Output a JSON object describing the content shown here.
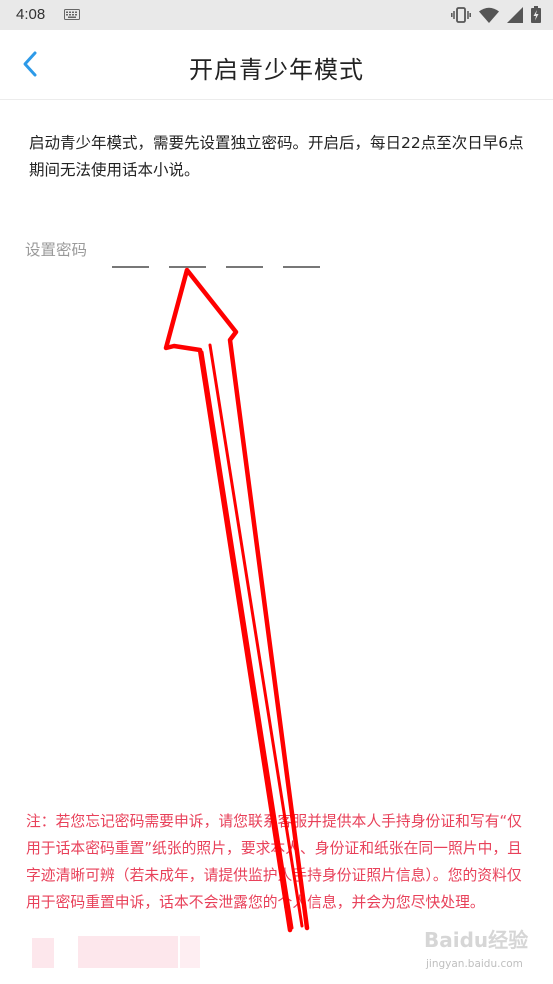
{
  "status_bar": {
    "time": "4:08",
    "icons": [
      "keyboard-icon",
      "vibrate-icon",
      "wifi-icon",
      "signal-icon",
      "battery-charging-icon"
    ]
  },
  "nav": {
    "back_icon": "chevron-left-icon",
    "title": "开启青少年模式"
  },
  "intro": {
    "text": "启动青少年模式，需要先设置独立密码。开启后，每日22点至次日早6点期间无法使用话本小说。"
  },
  "password": {
    "label": "设置密码",
    "slot_count": 4
  },
  "notice": {
    "text": "注：若您忘记密码需要申诉，请您联系客服并提供本人手持身份证和写有“仅用于话本密码重置”纸张的照片，要求本人、身份证和纸张在同一照片中，且字迹清晰可辨（若未成年，请提供监护人手持身份证照片信息）。您的资料仅用于密码重置申诉，话本不会泄露您的个人信息，并会为您尽快处理。"
  },
  "watermark": {
    "logo": "Baidu经验",
    "site": "jingyan.baidu.com"
  },
  "colors": {
    "accent_blue": "#2d9ae8",
    "notice_red": "#e8415a",
    "annotation_red": "#ff0000"
  }
}
